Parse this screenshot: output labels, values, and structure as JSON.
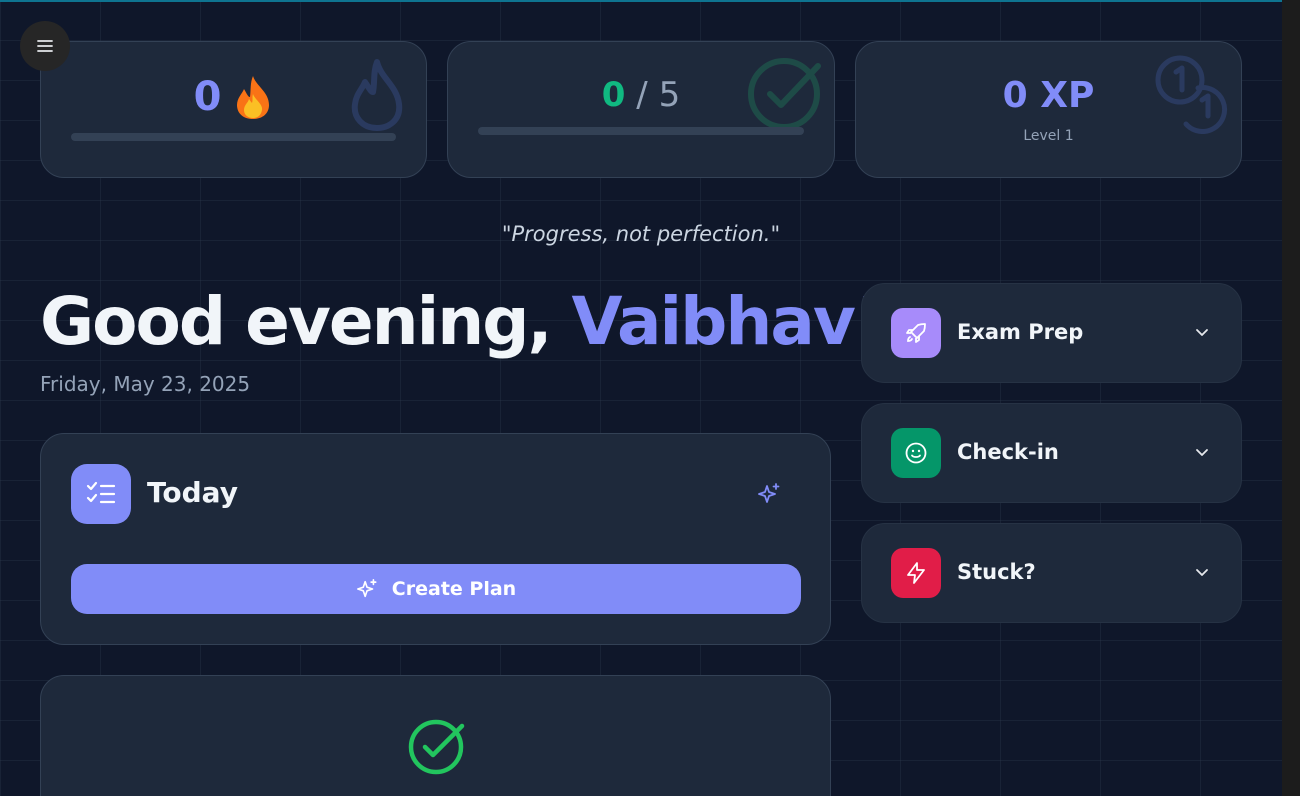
{
  "stats": {
    "streak": {
      "value": "0",
      "emoji": "🔥"
    },
    "tasks": {
      "done": "0",
      "separator": "/",
      "total": "5",
      "progress": 0
    },
    "xp": {
      "value": "0 XP",
      "level": "Level 1"
    }
  },
  "quote": "\"Progress, not perfection.\"",
  "greeting": {
    "prefix": "Good evening, ",
    "name": "Vaibhav!"
  },
  "date": "Friday, May 23, 2025",
  "today": {
    "title": "Today",
    "create_label": "Create Plan"
  },
  "sidebar": {
    "items": [
      {
        "label": "Exam Prep",
        "icon": "rocket-icon",
        "color": "#a78bfa"
      },
      {
        "label": "Check-in",
        "icon": "smile-icon",
        "color": "#059669"
      },
      {
        "label": "Stuck?",
        "icon": "lightning-icon",
        "color": "#e11d48"
      }
    ]
  },
  "colors": {
    "accent": "#818cf8",
    "success": "#22c55e",
    "background": "#0f172a",
    "card": "#1e293b"
  }
}
